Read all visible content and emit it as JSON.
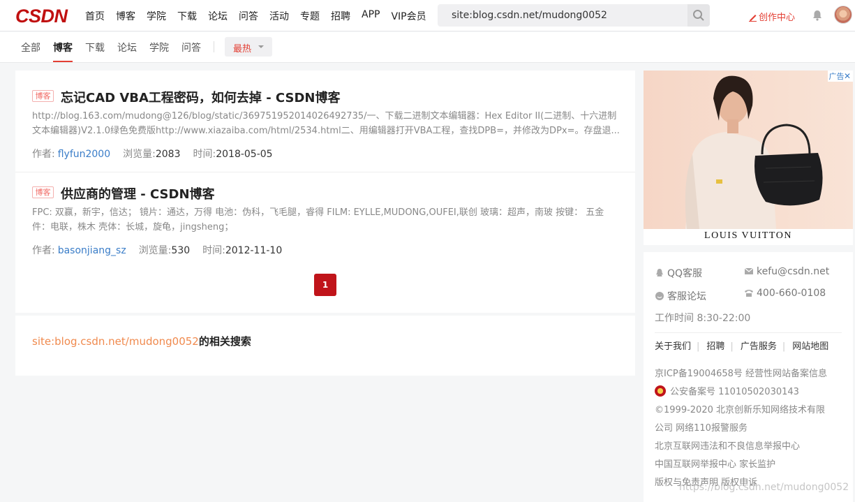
{
  "logo": "CSDN",
  "nav": [
    "首页",
    "博客",
    "学院",
    "下载",
    "论坛",
    "问答",
    "活动",
    "专题",
    "招聘",
    "APP",
    "VIP会员"
  ],
  "search": {
    "query": "site:blog.csdn.net/mudong0052"
  },
  "create_label": "创作中心",
  "tabs": [
    "全部",
    "博客",
    "下载",
    "论坛",
    "学院",
    "问答"
  ],
  "active_tab": "博客",
  "sort_label": "最热",
  "results": [
    {
      "tag": "博客",
      "title": "忘记CAD VBA工程密码，如何去掉 - CSDN博客",
      "desc": "http://blog.163.com/mudong@126/blog/static/369751952014026492735/一、下载二进制文本编辑器：Hex Editor II(二进制、十六进制文本编辑器)V2.1.0绿色免费版http://www.xiazaiba.com/html/2534.html二、用编辑器打开VBA工程，查找DPB=，并修改为DPx=。存盘退...",
      "author_label": "作者:",
      "author": "flyfun2000",
      "views_label": "浏览量:",
      "views": "2083",
      "time_label": "时间:",
      "time": "2018-05-05"
    },
    {
      "tag": "博客",
      "title": "供应商的管理 - CSDN博客",
      "desc": "FPC: 双赢，新宇，信达；  镜片：通达，万得 电池：伪科，飞毛腿，睿得 FILM: EYLLE,MUDONG,OUFEI,联创 玻璃：超声，南玻 按键：  五金件：电联，株木 壳体：长城，旋龟，jingsheng；",
      "author_label": "作者:",
      "author": "basonjiang_sz",
      "views_label": "浏览量:",
      "views": "530",
      "time_label": "时间:",
      "time": "2012-11-10"
    }
  ],
  "pagination": {
    "current": "1"
  },
  "related": {
    "keyword": "site:blog.csdn.net/mudong0052",
    "suffix": "的相关搜索"
  },
  "ad": {
    "label": "广告",
    "brand": "LOUIS VUITTON"
  },
  "footer": {
    "qq": "QQ客服",
    "email": "kefu@csdn.net",
    "forum": "客服论坛",
    "phone": "400-660-0108",
    "worktime": "工作时间 8:30-22:00",
    "links": [
      "关于我们",
      "招聘",
      "广告服务",
      "网站地图"
    ],
    "lines": [
      "京ICP备19004658号  经营性网站备案信息",
      "公安备案号 11010502030143",
      "©1999-2020 北京创新乐知网络技术有限",
      "公司    网络110报警服务",
      "北京互联网违法和不良信息举报中心",
      "中国互联网举报中心  家长监护",
      "版权与免责声明  版权申诉"
    ]
  },
  "watermark": "https://blog.csdn.net/mudong0052"
}
